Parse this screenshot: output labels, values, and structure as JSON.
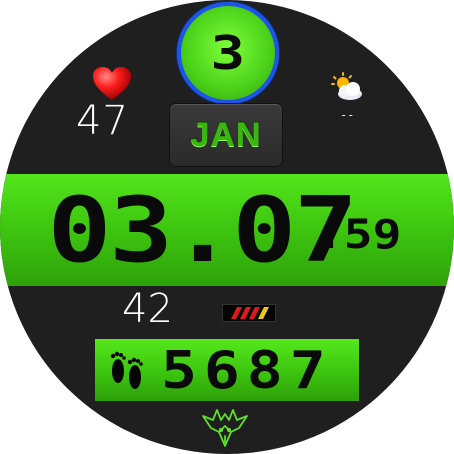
{
  "day": {
    "number": "3"
  },
  "heart_rate": {
    "value": "47",
    "icon": "heart-icon"
  },
  "weather": {
    "value": "--",
    "icon": "partly-cloudy-icon"
  },
  "date": {
    "month": "JAN"
  },
  "time": {
    "hours_minutes": "03.07",
    "seconds": ".59"
  },
  "temperature": {
    "value": "42"
  },
  "steps": {
    "value": "5687",
    "icon": "footprints-icon"
  },
  "colors": {
    "accent_green": "#3dc50f",
    "ring_blue": "#1c55e8",
    "background": "#1f1f1f"
  }
}
